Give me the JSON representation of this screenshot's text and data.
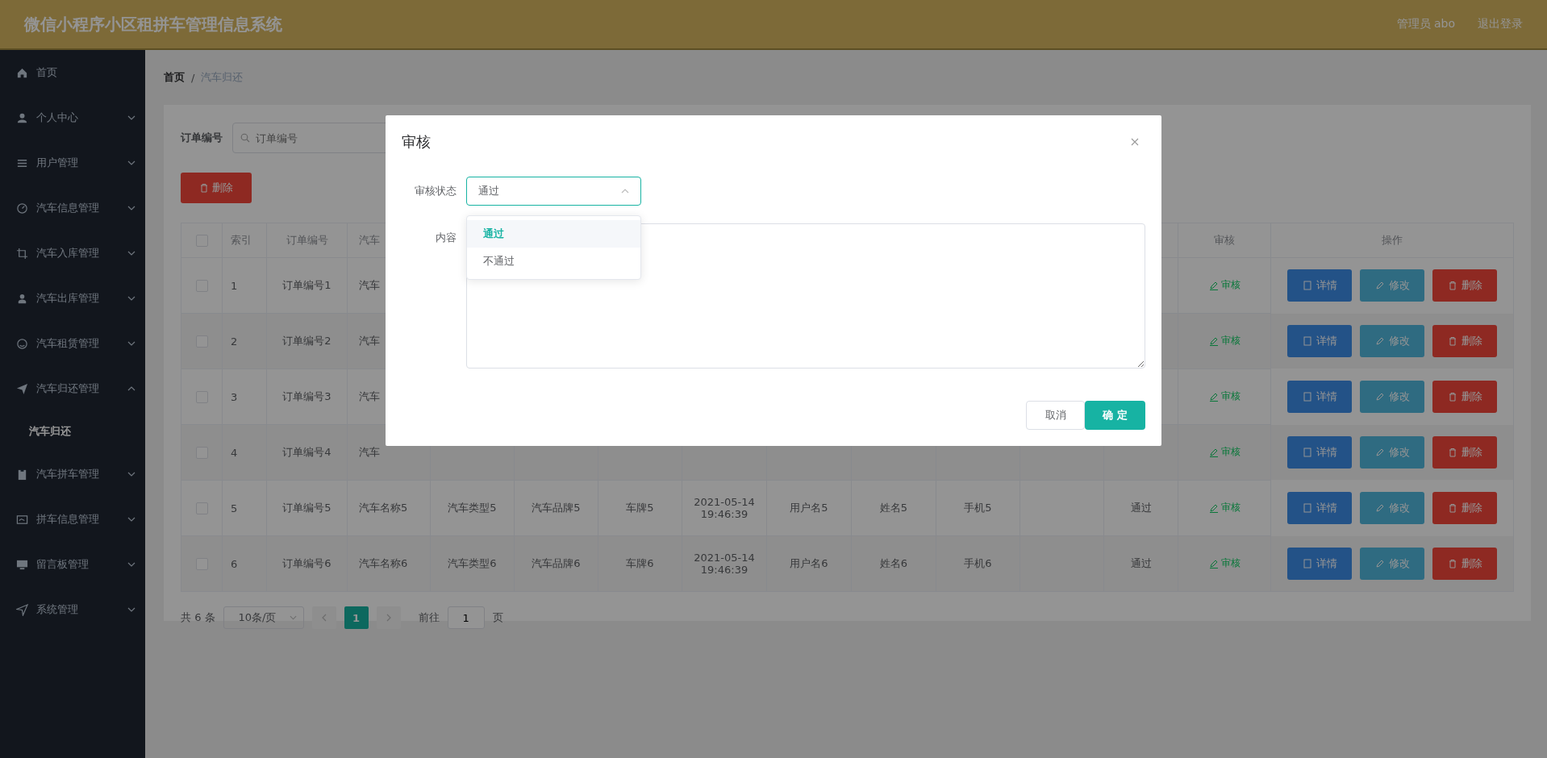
{
  "header": {
    "title": "微信小程序小区租拼车管理信息系统",
    "user": "管理员 abo",
    "logout": "退出登录"
  },
  "sidebar": {
    "items": [
      {
        "label": "首页",
        "kind": "link"
      },
      {
        "label": "个人中心",
        "kind": "menu",
        "expanded": false
      },
      {
        "label": "用户管理",
        "kind": "menu",
        "expanded": false
      },
      {
        "label": "汽车信息管理",
        "kind": "menu",
        "expanded": false
      },
      {
        "label": "汽车入库管理",
        "kind": "menu",
        "expanded": false
      },
      {
        "label": "汽车出库管理",
        "kind": "menu",
        "expanded": false
      },
      {
        "label": "汽车租赁管理",
        "kind": "menu",
        "expanded": false
      },
      {
        "label": "汽车归还管理",
        "kind": "menu",
        "expanded": true,
        "children": [
          {
            "label": "汽车归还",
            "selected": true
          }
        ]
      },
      {
        "label": "汽车拼车管理",
        "kind": "menu",
        "expanded": false
      },
      {
        "label": "拼车信息管理",
        "kind": "menu",
        "expanded": false
      },
      {
        "label": "留言板管理",
        "kind": "menu",
        "expanded": false
      },
      {
        "label": "系统管理",
        "kind": "menu",
        "expanded": false
      }
    ]
  },
  "breadcrumb": {
    "items": [
      "首页",
      "汽车归还"
    ],
    "separator": "/"
  },
  "search": {
    "label": "订单编号",
    "placeholder": "订单编号"
  },
  "delete_button": "删除",
  "table": {
    "select_all": {
      "checked": false
    },
    "columns": [
      "索引",
      "订单编号",
      "汽车",
      null,
      null,
      null,
      null,
      null,
      null,
      null,
      null,
      null,
      "审核",
      "操作"
    ],
    "rows": [
      {
        "checked": false,
        "cells": [
          "1",
          "订单编号1",
          "汽车",
          null,
          null,
          null,
          null,
          null,
          null,
          null,
          null,
          null
        ],
        "review": "审核",
        "actions": [
          "详情",
          "修改",
          "删除"
        ]
      },
      {
        "checked": false,
        "cells": [
          "2",
          "订单编号2",
          "汽车",
          null,
          null,
          null,
          null,
          null,
          null,
          null,
          null,
          null
        ],
        "review": "审核",
        "actions": [
          "详情",
          "修改",
          "删除"
        ]
      },
      {
        "checked": false,
        "cells": [
          "3",
          "订单编号3",
          "汽车",
          null,
          null,
          null,
          null,
          null,
          null,
          null,
          null,
          null
        ],
        "review": "审核",
        "actions": [
          "详情",
          "修改",
          "删除"
        ]
      },
      {
        "checked": false,
        "cells": [
          "4",
          "订单编号4",
          "汽车",
          null,
          null,
          null,
          null,
          null,
          null,
          null,
          null,
          null
        ],
        "review": "审核",
        "actions": [
          "详情",
          "修改",
          "删除"
        ]
      },
      {
        "checked": false,
        "cells": [
          "5",
          "订单编号5",
          "汽车名称5",
          "汽车类型5",
          "汽车品牌5",
          "车牌5",
          "2021-05-14 19:46:39",
          "用户名5",
          "姓名5",
          "手机5",
          null,
          "通过"
        ],
        "review": "审核",
        "actions": [
          "详情",
          "修改",
          "删除"
        ]
      },
      {
        "checked": false,
        "cells": [
          "6",
          "订单编号6",
          "汽车名称6",
          "汽车类型6",
          "汽车品牌6",
          "车牌6",
          "2021-05-14 19:46:39",
          "用户名6",
          "姓名6",
          "手机6",
          null,
          "通过"
        ],
        "review": "审核",
        "actions": [
          "详情",
          "修改",
          "删除"
        ]
      }
    ]
  },
  "pagination": {
    "total": "共 6 条",
    "page_size": "10条/页",
    "pages": [
      {
        "label": "1",
        "selected": true
      }
    ],
    "goto_label": "前往",
    "goto_value": "1",
    "goto_suffix": "页"
  },
  "dialog": {
    "title": "审核",
    "status_label": "审核状态",
    "status_value": "通过",
    "dropdown_open": true,
    "options": [
      {
        "label": "通过",
        "selected": true
      },
      {
        "label": "不通过",
        "selected": false
      }
    ],
    "content_label": "内容",
    "cancel": "取消",
    "confirm": "确 定"
  }
}
